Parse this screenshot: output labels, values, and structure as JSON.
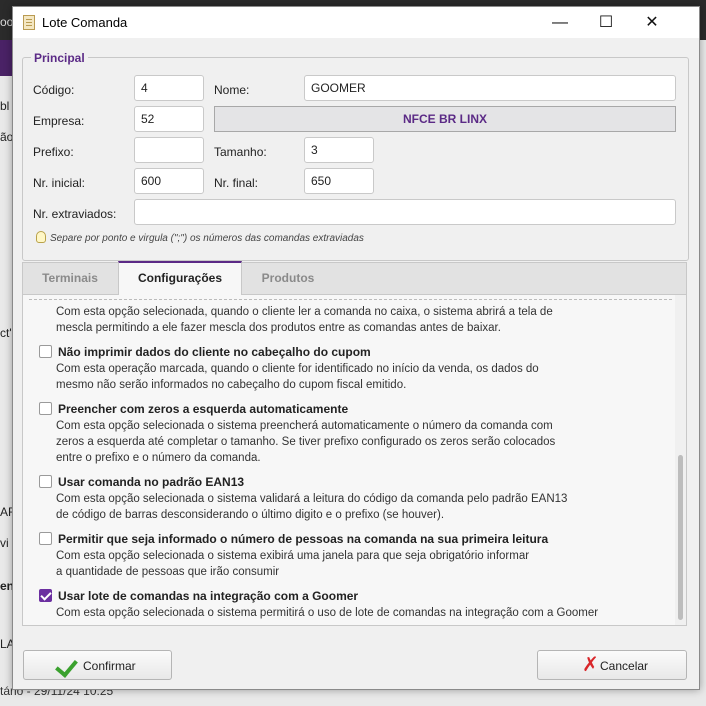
{
  "background": {
    "fragments": [
      "oo",
      "bl",
      "ão",
      "ct'",
      "AR",
      "vi",
      "en",
      "LA"
    ],
    "status_text": "tário - 29/11/24 10:25"
  },
  "window": {
    "title": "Lote Comanda",
    "minimize_glyph": "—",
    "maximize_glyph": "☐",
    "close_glyph": "✕"
  },
  "principal": {
    "group_title": "Principal",
    "codigo_label": "Código:",
    "codigo_value": "4",
    "nome_label": "Nome:",
    "nome_value": "GOOMER",
    "empresa_label": "Empresa:",
    "empresa_value": "52",
    "empresa_name": "NFCE BR LINX",
    "prefixo_label": "Prefixo:",
    "prefixo_value": "",
    "tamanho_label": "Tamanho:",
    "tamanho_value": "3",
    "nr_inicial_label": "Nr. inicial:",
    "nr_inicial_value": "600",
    "nr_final_label": "Nr. final:",
    "nr_final_value": "650",
    "extraviados_label": "Nr. extraviados:",
    "extraviados_value": "",
    "hint": "Separe por ponto e virgula (\";\") os números das comandas extraviadas"
  },
  "tabs": [
    {
      "label": "Terminais",
      "active": false
    },
    {
      "label": "Configurações",
      "active": true
    },
    {
      "label": "Produtos",
      "active": false
    }
  ],
  "options": {
    "top_desc": "Com esta opção selecionada, quando o cliente ler a comanda no caixa, o sistema abrirá a tela de\nmescla  permitindo a ele fazer mescla dos produtos entre as comandas antes de baixar.",
    "items": [
      {
        "title": "Não imprimir dados do cliente no cabeçalho do cupom",
        "checked": false,
        "desc": "Com esta operação marcada, quando o cliente for identificado no início da venda, os dados do\nmesmo não serão informados no cabeçalho do cupom fiscal emitido."
      },
      {
        "title": "Preencher com zeros a esquerda automaticamente",
        "checked": false,
        "desc": "Com esta opção selecionada o sistema preencherá automaticamente o número da comanda com\nzeros a esquerda até completar o tamanho. Se tiver prefixo configurado os zeros serão colocados\nentre o prefixo e o número da comanda."
      },
      {
        "title": "Usar comanda no padrão EAN13",
        "checked": false,
        "desc": "Com esta opção selecionada o sistema validará a leitura do código da comanda pelo padrão EAN13\nde código de barras desconsiderando o último digito e o prefixo (se houver)."
      },
      {
        "title": "Permitir que seja informado o número de pessoas na comanda na sua primeira leitura",
        "checked": false,
        "desc": "Com esta opção selecionada o sistema exibirá uma janela para que seja obrigatório informar\na quantidade de pessoas que irão consumir"
      },
      {
        "title": "Usar lote de comandas na integração com a Goomer",
        "checked": true,
        "desc": "Com esta opção selecionada o sistema permitirá o uso de lote de comandas na integração com a Goomer"
      }
    ]
  },
  "buttons": {
    "confirm": "Confirmar",
    "cancel": "Cancelar"
  },
  "colors": {
    "accent": "#5b2a86",
    "checkbox_checked": "#6b2fa0",
    "confirm_icon": "#3aa12e",
    "cancel_icon": "#d9262a"
  }
}
